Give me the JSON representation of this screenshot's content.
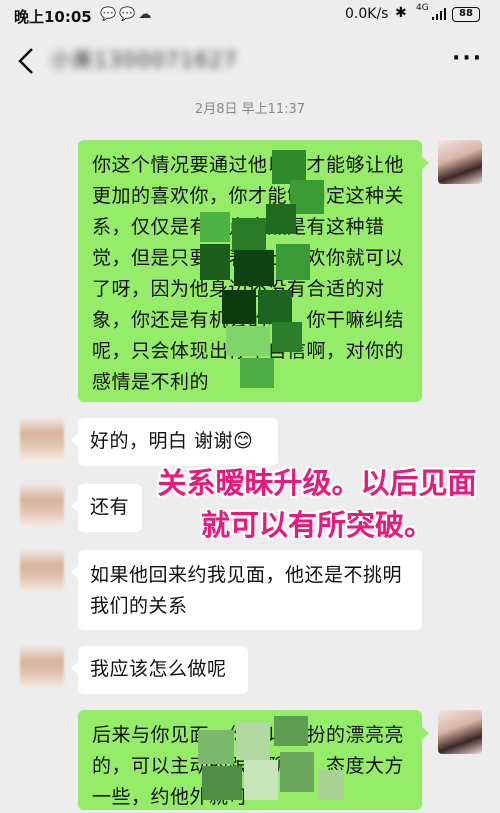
{
  "status_bar": {
    "time": "晚上10:05",
    "notification_icons": [
      "wechat-icon",
      "wechat-icon",
      "cloud-icon"
    ],
    "net_speed": "0.0K/s",
    "network": "4G",
    "battery": "88"
  },
  "nav": {
    "title": "小美1300071627",
    "back_icon": "chevron-left-icon",
    "more_icon": "more-dots-icon"
  },
  "timestamp": "2月8日 早上11:37",
  "messages": [
    {
      "side": "sent",
      "text": "你这个情况要通过他以后才能够让他更加的喜欢你，你才能够确定这种关系，仅仅是有一点当然是有这种错觉，但是只要是表现出喜欢你就可以了呀，因为他身边还没有合适的对象，你还是有机会的呀，你干嘛纠结呢，只会体现出你不自信啊，对你的感情是不利的"
    },
    {
      "side": "recv",
      "text": "好的，明白 谢谢😊"
    },
    {
      "side": "recv",
      "text": "还有"
    },
    {
      "side": "recv",
      "text": "如果他回来约我见面，他还是不挑明我们的关系"
    },
    {
      "side": "recv",
      "text": "我应该怎么做呢"
    },
    {
      "side": "sent",
      "text": "后来与你见面，你可以打扮的漂亮亮的，可以主动的跟他聊天，态度大方一些，约他外就可"
    }
  ],
  "overlay_caption": {
    "line1": "关系暧昧升级。以后见面",
    "line2": "就可以有所突破。",
    "color": "#e8197c"
  },
  "colors": {
    "background": "#ededed",
    "sent_bubble": "#95ec69",
    "recv_bubble": "#ffffff"
  }
}
